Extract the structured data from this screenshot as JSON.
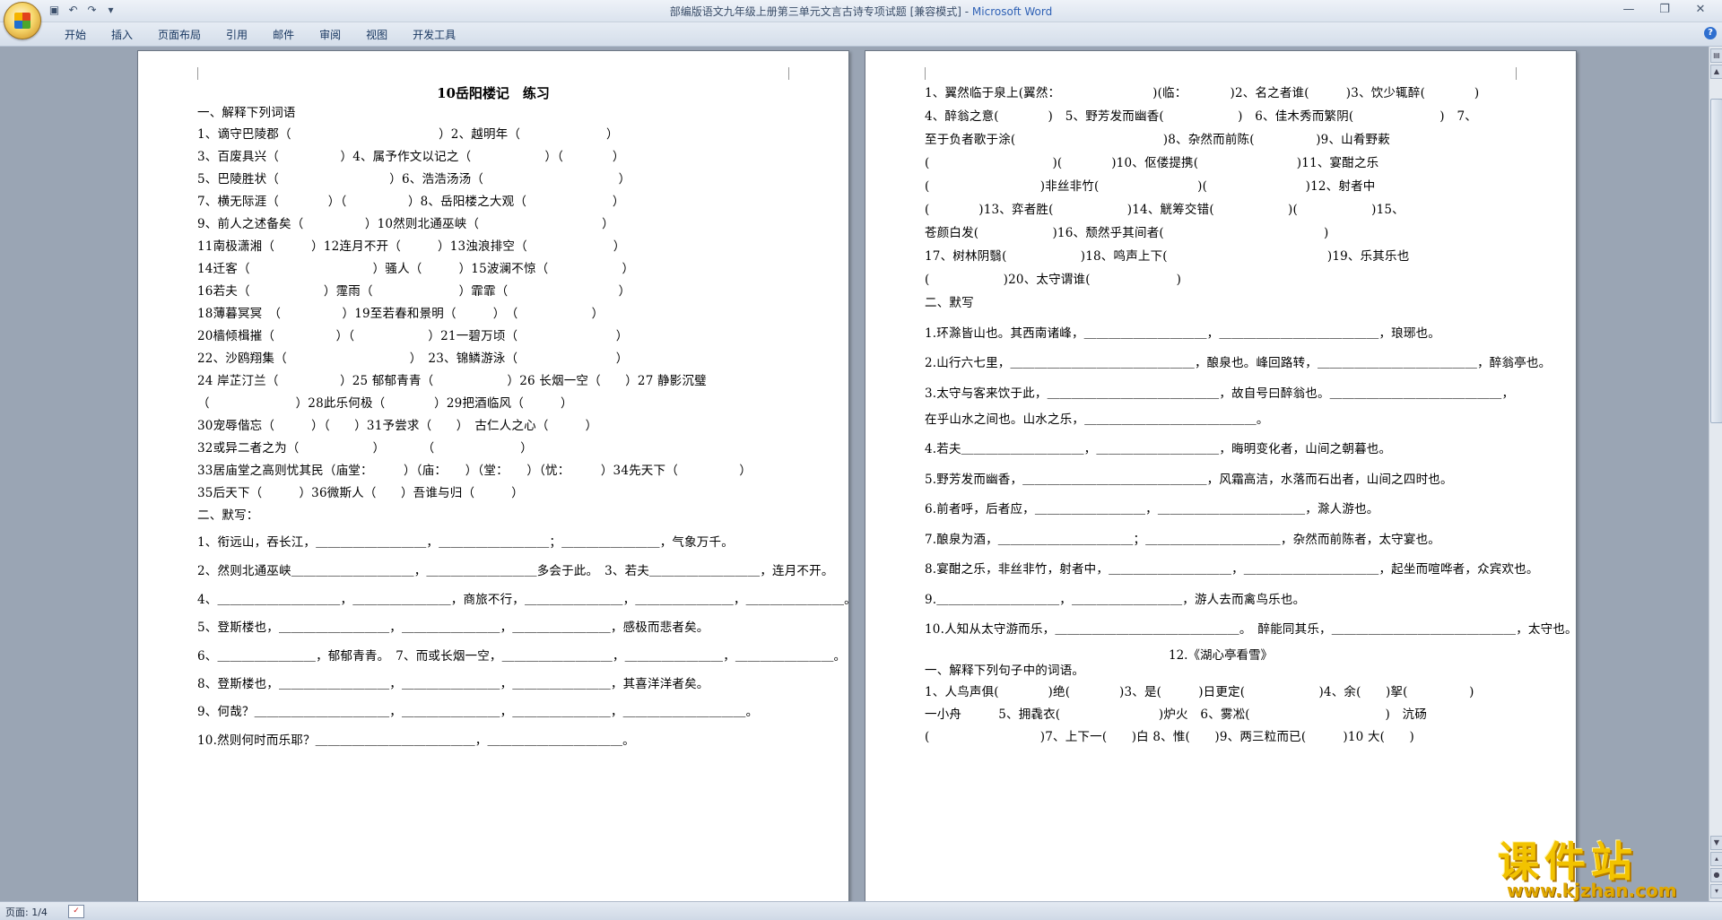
{
  "window": {
    "title": "部编版语文九年级上册第三单元文言古诗专项试题 [兼容模式] - ",
    "app_name": "Microsoft Word"
  },
  "ribbon": {
    "tabs": [
      "开始",
      "插入",
      "页面布局",
      "引用",
      "邮件",
      "审阅",
      "视图",
      "开发工具"
    ]
  },
  "left_page": {
    "title": "10岳阳楼记　练习",
    "lines": [
      "一、解释下列词语",
      "1、谪守巴陵郡（　　　　　　　　　　　　）2、越明年（　　　　　　　）",
      "3、百废具兴（　　　　　）4、属予作文以记之（　　　　　　）（　　　　）",
      "5、巴陵胜状（　　　　　　　　　）6、浩浩汤汤（　　　　　　　　　　　）",
      "7、横无际涯（　　　　）（　　　　　）8、岳阳楼之大观（　　　　　　　）",
      "9、前人之述备矣（　　　　　）10然则北通巫峡（　　　　　　　　　　）",
      "11南极潇湘（　　　）12连月不开（　　　）13浊浪排空（　　　　　　　）",
      "14迁客（　　　　　　　　　　）骚人（　　　）15波澜不惊（　　　　　　）",
      "16若夫（　　　　　　）霪雨（　　　　　　　）霏霏（　　　　　　　　　）",
      "18薄暮冥冥　（　　　　　）19至若春和景明（　　　）　（　　　　　　）",
      "20樯倾楫摧（　　　　　）（　　　　　　）21一碧万顷（　　　　　　　　）",
      "22、沙鸥翔集（　　　　　　　　　　）　23、锦鳞游泳（　　　　　　　　）",
      "24 岸芷汀兰（　　　　　）25 郁郁青青（　　　　　　）26 长烟一空（　　）27 静影沉璧",
      "（　　　　　　　）28此乐何极（　　　　）29把酒临风（　　　）",
      "30宠辱偕忘（　　　）（　　）31予尝求（　　）　古仁人之心（　　　）",
      "32或异二者之为（　　　　　　）　　　　（　　　　　　　）",
      "33居庙堂之高则忧其民（庙堂：　　　）（庙：　　）（堂：　　）（忧：　　　）34先天下（　　　　　）",
      "35后天下（　　　）36微斯人（　　）吾谁与归（　　　）",
      "二、默写：",
      "1、衔远山，吞长江，＿＿＿＿＿＿＿＿＿，＿＿＿＿＿＿＿＿＿；＿＿＿＿＿＿＿＿，气象万千。",
      "2、然则北通巫峡＿＿＿＿＿＿＿＿＿＿，＿＿＿＿＿＿＿＿＿多会于此。　3、若夫＿＿＿＿＿＿＿＿＿，连月不开。",
      "4、＿＿＿＿＿＿＿＿＿＿，＿＿＿＿＿＿＿＿，商旅不行，＿＿＿＿＿＿＿＿，＿＿＿＿＿＿＿＿，＿＿＿＿＿＿＿＿。",
      "5、登斯楼也，＿＿＿＿＿＿＿＿＿，＿＿＿＿＿＿＿＿，＿＿＿＿＿＿＿＿，感极而悲者矣。",
      "6、＿＿＿＿＿＿＿＿，郁郁青青。　7、而或长烟一空，＿＿＿＿＿＿＿＿＿，＿＿＿＿＿＿＿＿，＿＿＿＿＿＿＿＿。",
      "8、登斯楼也，＿＿＿＿＿＿＿＿＿，＿＿＿＿＿＿＿＿，＿＿＿＿＿＿＿＿，其喜洋洋者矣。",
      "9、何哉？＿＿＿＿＿＿＿＿＿＿＿，＿＿＿＿＿＿＿＿，＿＿＿＿＿＿＿＿，＿＿＿＿＿＿＿＿＿＿。",
      "10.然则何时而乐耶？＿＿＿＿＿＿＿＿＿＿＿＿＿，＿＿＿＿＿＿＿＿＿＿＿。"
    ]
  },
  "right_page": {
    "lines": [
      "1、翼然临于泉上(翼然：　　　　　　　　)(临：　　　　)2、名之者谁(　　　)3、饮少辄醉(　　　　)",
      "4、醉翁之意(　　　　)　5、野芳发而幽香(　　　　　　)　6、佳木秀而繁阴(　　　　　　　)　7、",
      "至于负者歌于涂(　　　　　　　　　　　　)8、杂然而前陈(　　　　　)9、山肴野蔌",
      "(　　　　　　　　　　)(　　　　)10、伛偻提携(　　　　　　　　)11、宴酣之乐",
      "(　　　　　　　　　)非丝非竹(　　　　　　　　)(　　　　　　　　)12、射者中",
      "(　　　　)13、弈者胜(　　　　　　)14、觥筹交错(　　　　　　)(　　　　　　)15、",
      "苍颜白发(　　　　　　)16、颓然乎其间者(　　　　　　　　　　　　　)",
      "17、树林阴翳(　　　　　　)18、鸣声上下(　　　　　　　　　　　　　)19、乐其乐也",
      "(　　　　　　)20、太守谓谁(　　　　　　　)",
      "二、默写",
      "1.环滁皆山也。其西南诸峰，＿＿＿＿＿＿＿＿＿＿，＿＿＿＿＿＿＿＿＿＿＿＿＿，琅琊也。",
      "2.山行六七里，＿＿＿＿＿＿＿＿＿＿＿＿＿＿＿，酿泉也。峰回路转，＿＿＿＿＿＿＿＿＿＿＿＿＿，醉翁亭也。",
      "3.太守与客来饮于此，＿＿＿＿＿＿＿＿＿＿＿＿＿＿，故自号曰醉翁也。＿＿＿＿＿＿＿＿＿＿＿＿＿＿，",
      "在乎山水之间也。山水之乐，＿＿＿＿＿＿＿＿＿＿＿＿＿＿。",
      "4.若夫＿＿＿＿＿＿＿＿＿＿，＿＿＿＿＿＿＿＿＿＿，晦明变化者，山间之朝暮也。",
      "5.野芳发而幽香，＿＿＿＿＿＿＿＿＿＿＿＿＿＿＿，风霜高洁，水落而石出者，山间之四时也。",
      "6.前者呼，后者应，＿＿＿＿＿＿＿＿＿，＿＿＿＿＿＿＿＿＿＿＿＿，滁人游也。",
      "7.酿泉为酒，＿＿＿＿＿＿＿＿＿＿＿；＿＿＿＿＿＿＿＿＿＿＿，杂然而前陈者，太守宴也。",
      "8.宴酣之乐，非丝非竹，射者中，＿＿＿＿＿＿＿＿＿＿，＿＿＿＿＿＿＿＿＿＿＿，起坐而喧哗者，众宾欢也。",
      "9.＿＿＿＿＿＿＿＿＿＿，＿＿＿＿＿＿＿＿＿，游人去而禽鸟乐也。",
      "10.人知从太守游而乐，＿＿＿＿＿＿＿＿＿＿＿＿＿＿＿。　醉能同其乐，＿＿＿＿＿＿＿＿＿＿＿＿＿＿＿，太守也。",
      "一、解释下列句子中的词语。",
      "1、人鸟声俱(　　　　)绝(　　　　)3、是(　　　)日更定(　　　　　　)4、余(　　)挐(　　　　　)",
      "一小舟　　　5、拥毳衣(　　　　　　　　)炉火　6、雾凇(　　　　　　　　　　　)　沆砀",
      "(　　　　　　　　　)7、上下一(　　)白 8、惟(　　)9、两三粒而已(　　　)10 大(　　)"
    ],
    "section_title": "12.《湖心亭看雪》"
  },
  "status": {
    "pages": "页面: 1/4"
  },
  "watermark": {
    "main": "课件站",
    "url": "www.kjzhan.com"
  }
}
